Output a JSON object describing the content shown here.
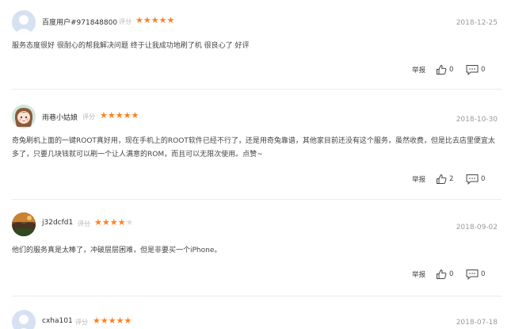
{
  "labels": {
    "rating": "评分",
    "report": "举报"
  },
  "colors": {
    "star_active": "#ff7f1f",
    "star_inactive": "#dcdcdc",
    "divider": "#ebebeb"
  },
  "reviews": [
    {
      "username": "百度用户#971848800",
      "avatar": "default-avatar-icon",
      "rating": 5,
      "date": "2018-12-25",
      "content": "服务态度很好 很耐心的帮我解决问题 终于让我成功地刷了机 很良心了 好评",
      "likes": "0",
      "comments": "0"
    },
    {
      "username": "雨巷小姑娘",
      "avatar": "cartoon-girl-avatar",
      "rating": 5,
      "date": "2018-10-30",
      "content": "奇兔刷机上面的一键ROOT真好用，现在手机上的ROOT软件已经不行了，还是用奇兔靠谱，其他家目前还没有这个服务，虽然收费，但是比去店里便宜太多了，只要几块钱就可以刷一个让人满意的ROM，而且可以无限次使用。点赞~",
      "likes": "2",
      "comments": "0"
    },
    {
      "username": "j32dcfd1",
      "avatar": "landscape-photo-avatar",
      "rating": 4,
      "date": "2018-09-02",
      "content": "他们的服务真是太棒了，冲破层层困难，但是非要买一个iPhone。",
      "likes": "0",
      "comments": "0"
    },
    {
      "username": "cxha101",
      "avatar": "default-avatar-icon",
      "rating": 5,
      "date": "2018-07-18",
      "content": "",
      "likes": "",
      "comments": ""
    }
  ]
}
